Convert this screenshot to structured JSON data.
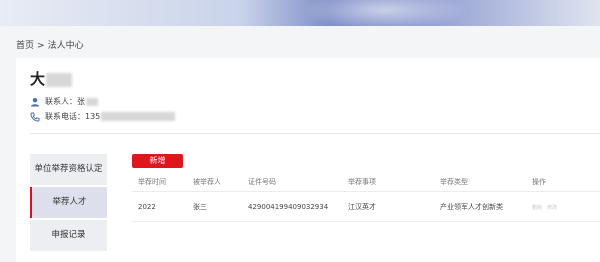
{
  "breadcrumb": {
    "home": "首页",
    "separator": ">",
    "current": "法人中心"
  },
  "profile": {
    "name_visible": "大",
    "contact_label": "联系人：",
    "contact_visible": "张",
    "phone_label": "联系电话：",
    "phone_visible": "135"
  },
  "menu": {
    "items": [
      {
        "label": "单位举荐资格认定"
      },
      {
        "label": "举荐人才"
      },
      {
        "label": "申报记录"
      }
    ],
    "active_index": 1
  },
  "toolbar": {
    "add_label": "新增"
  },
  "table": {
    "headers": [
      "举荐时间",
      "被举荐人",
      "证件号码",
      "举荐事项",
      "举荐类型",
      "操作"
    ],
    "rows": [
      {
        "time": "2022",
        "person": "张三",
        "id_number": "429004199409032934",
        "item": "江汉英才",
        "type": "产业领军人才创新类",
        "actions": [
          "删除",
          "修改"
        ]
      }
    ]
  },
  "colors": {
    "accent": "#e0161d",
    "menu_bg": "#edeef2",
    "menu_active_bg": "#dde0ec",
    "icon_blue": "#4a6fb5"
  }
}
